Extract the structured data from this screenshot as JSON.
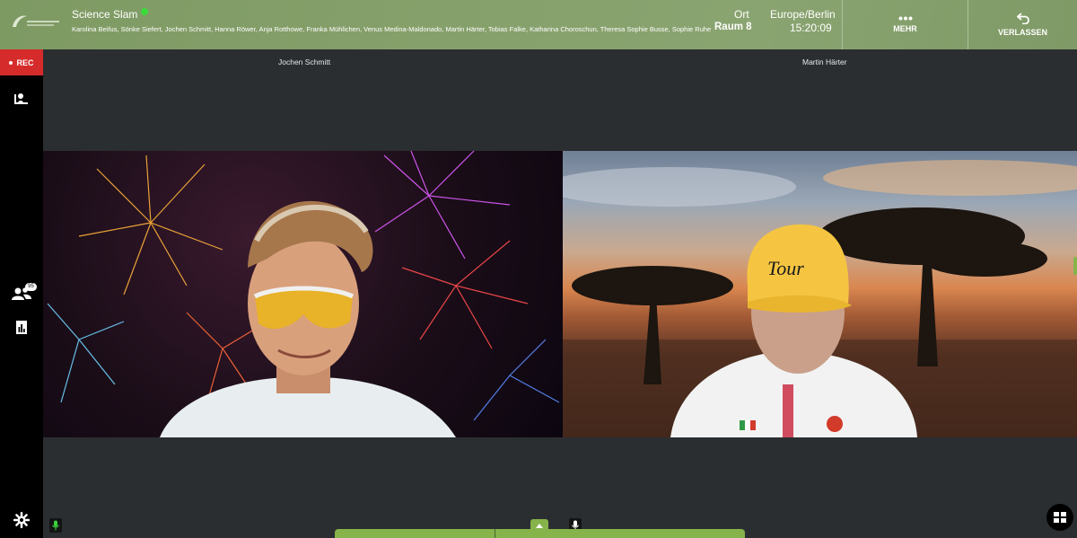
{
  "header": {
    "title": "Science Slam",
    "participants": "Karolina Beifus, Sönke Siefert, Jochen Schmitt, Hanna Röwer, Anja Rotthowe, Franka Mühlichen, Venus Medina-Maldonado, Martin Härter, Tobias Falke, Katharina Choroschun, Theresa Sophie Busse, Sophie Ruhe",
    "location_label": "Ort",
    "location_value": "Raum 8",
    "timezone_label": "Europe/Berlin",
    "time_value": "15:20:09",
    "more_label": "MEHR",
    "leave_label": "VERLASSEN"
  },
  "sidebar": {
    "rec_label": "REC",
    "participant_count": "95"
  },
  "videos": [
    {
      "name": "Jochen Schmitt"
    },
    {
      "name": "Martin Härter"
    }
  ],
  "colors": {
    "header_green": "#86a06b",
    "rec_red": "#d62b2b",
    "accent_green": "#86b34a",
    "online_green": "#3adc3a",
    "stage_bg": "#2b2e31"
  },
  "icons": {
    "more": "more-dots-icon",
    "leave": "leave-arrow-icon",
    "presenter": "presenter-icon",
    "participants": "participants-icon",
    "poll": "poll-chart-icon",
    "settings": "gear-icon",
    "mic": "microphone-icon",
    "layout": "grid-layout-icon"
  }
}
